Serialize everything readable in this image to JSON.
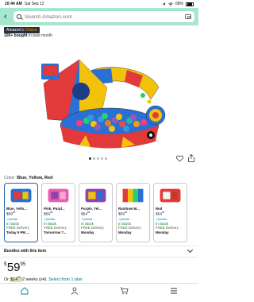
{
  "status_bar": {
    "time": "10:44 AM",
    "date": "Sat Sep 12",
    "battery": "68%"
  },
  "search": {
    "placeholder": "Search Amazon.com"
  },
  "badge": {
    "prefix": "Amazon's",
    "choice": "Choice"
  },
  "bought": {
    "count": "100+ bought",
    "suffix": " in past month"
  },
  "image_dots": {
    "total": 5,
    "active": 0
  },
  "color": {
    "label": "Color: ",
    "value": "Blue, Yellow, Red"
  },
  "swatches": [
    {
      "name": "Blue, Yello...",
      "price_whole": "$59",
      "price_frac": "95",
      "prime": "✓prime",
      "stock": "In Stock",
      "delivery": "FREE Delivery",
      "day": "Today 5 PM ...",
      "selected": true
    },
    {
      "name": "Pink, Purpl...",
      "price_whole": "$59",
      "price_frac": "95",
      "prime": "✓prime",
      "stock": "In Stock",
      "delivery": "FREE Delivery",
      "day": "Tomorrow 7...",
      "selected": false
    },
    {
      "name": "Purple, Yel...",
      "price_whole": "$54",
      "price_frac": "95",
      "prime": "✓prime",
      "stock": "In Stock",
      "delivery": "FREE Delivery",
      "day": "Monday",
      "selected": false
    },
    {
      "name": "Rainbow M...",
      "price_whole": "$59",
      "price_frac": "95",
      "prime": "✓prime",
      "stock": "In Stock",
      "delivery": "FREE Delivery",
      "day": "Monday",
      "selected": false
    },
    {
      "name": "Red",
      "price_whole": "$54",
      "price_frac": "95",
      "prime": "✓prime",
      "stock": "In Stock",
      "delivery": "FREE Delivery",
      "day": "Monday",
      "selected": false
    }
  ],
  "bundles": {
    "label": "Bundles with this item"
  },
  "price": {
    "currency": "$",
    "whole": "59",
    "fraction": "95"
  },
  "payment_plan": {
    "or": "Or ",
    "amount": "$14",
    "amount_frac": "99",
    "terms": "/2 weeks (x4).",
    "link": "Select from 1 plan"
  },
  "colors": {
    "header_bg": "#a6e7ce",
    "accent_blue": "#2162a1",
    "link": "#007185",
    "in_stock": "#007600"
  }
}
